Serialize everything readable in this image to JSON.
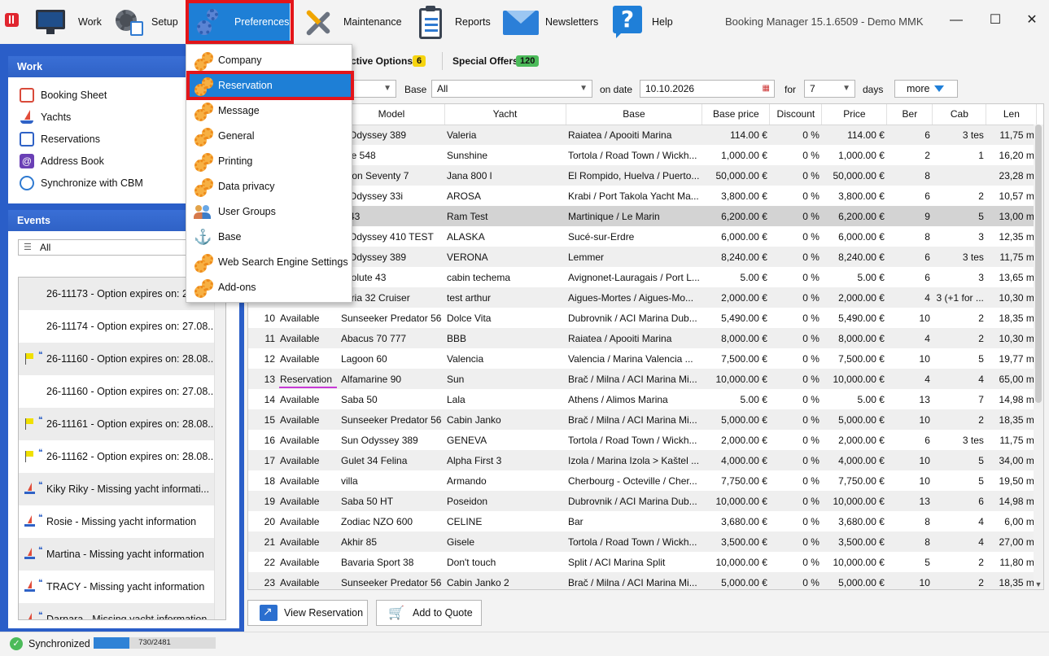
{
  "window": {
    "title": "Booking Manager 15.1.6509 - Demo MMK",
    "controls": {
      "minimize": "—",
      "maximize": "☐",
      "close": "✕"
    }
  },
  "toolbar": {
    "items": [
      {
        "label": "Work",
        "icon": "monitor-icon"
      },
      {
        "label": "Setup",
        "icon": "gear-clipboard-icon"
      },
      {
        "label": "Preferences",
        "icon": "gears-icon",
        "active": true
      },
      {
        "label": "Maintenance",
        "icon": "tools-icon"
      },
      {
        "label": "Reports",
        "icon": "clipboard-icon"
      },
      {
        "label": "Newsletters",
        "icon": "envelope-icon"
      },
      {
        "label": "Help",
        "icon": "help-icon",
        "glyph": "?"
      }
    ]
  },
  "preferences_menu": {
    "items": [
      {
        "label": "Company",
        "icon": "gears-icon"
      },
      {
        "label": "Reservation",
        "icon": "gears-icon",
        "active": true
      },
      {
        "label": "Message",
        "icon": "gears-icon"
      },
      {
        "label": "General",
        "icon": "gears-icon"
      },
      {
        "label": "Printing",
        "icon": "gears-icon"
      },
      {
        "label": "Data privacy",
        "icon": "gears-icon"
      },
      {
        "label": "User Groups",
        "icon": "user-groups-icon"
      },
      {
        "label": "Base",
        "icon": "anchor-icon",
        "glyph": "⚓"
      },
      {
        "label": "Web Search Engine Settings",
        "icon": "gears-icon"
      },
      {
        "label": "Add-ons",
        "icon": "gears-icon"
      }
    ]
  },
  "work_panel": {
    "title": "Work",
    "items": [
      {
        "label": "Booking Sheet",
        "icon": "calendar-icon"
      },
      {
        "label": "Yachts",
        "icon": "sailboat-icon"
      },
      {
        "label": "Reservations",
        "icon": "reservations-icon"
      },
      {
        "label": "Address Book",
        "icon": "address-book-icon",
        "glyph": "@"
      },
      {
        "label": "Synchronize with CBM",
        "icon": "sync-icon"
      }
    ]
  },
  "events_panel": {
    "title": "Events",
    "filter": "All",
    "items": [
      {
        "text": "26-11173 - Option expires on: 27.08...",
        "icon": ""
      },
      {
        "text": "26-11174 - Option expires on: 27.08...",
        "icon": ""
      },
      {
        "text": "26-11160 - Option expires on: 28.08...",
        "icon": "flag"
      },
      {
        "text": "26-11160 - Option expires on: 27.08...",
        "icon": ""
      },
      {
        "text": "26-11161 - Option expires on: 28.08...",
        "icon": "flag"
      },
      {
        "text": "26-11162 - Option expires on: 28.08...",
        "icon": "flag"
      },
      {
        "text": "Kiky Riky - Missing yacht informati...",
        "icon": "boat"
      },
      {
        "text": "Rosie - Missing yacht information",
        "icon": "boat"
      },
      {
        "text": "Martina - Missing yacht information",
        "icon": "boat"
      },
      {
        "text": "TRACY - Missing yacht information",
        "icon": "boat"
      },
      {
        "text": "Darnara - Missing yacht information",
        "icon": "boat"
      }
    ]
  },
  "summary": {
    "active_options_label": "ctive Options",
    "active_options_count": "6",
    "special_offers_label": "Special Offers",
    "special_offers_count": "120"
  },
  "filters": {
    "base_label": "Base",
    "base_value": "All",
    "date_label": "on date",
    "date_value": "10.10.2026",
    "for_label": "for",
    "days_value": "7",
    "days_label": "days",
    "more_label": "more"
  },
  "grid": {
    "columns": [
      "",
      "",
      "Model",
      "Yacht",
      "Base",
      "Base price",
      "Discount",
      "Price",
      "Ber",
      "Cab",
      "Len"
    ],
    "rows": [
      [
        "",
        "",
        "n Odyssey 389",
        "Valeria",
        "Raiatea / Apooiti Marina",
        "114.00 €",
        "0 %",
        "114.00 €",
        "6",
        "3 tes",
        "11,75 m"
      ],
      [
        "",
        "",
        "nse 548",
        "Sunshine",
        "Tortola / Road Town / Wickh...",
        "1,000.00 €",
        "0 %",
        "1,000.00 €",
        "2",
        "1",
        "16,20 m"
      ],
      [
        "",
        "",
        "goon Seventy 7",
        "Jana 800 l",
        "El Rompido, Huelva / Puerto...",
        "50,000.00 €",
        "0 %",
        "50,000.00 €",
        "8",
        "",
        "23,28 m"
      ],
      [
        "",
        "",
        "n Odyssey 33i",
        "AROSA",
        "Krabi / Port Takola Yacht Ma...",
        "3,800.00 €",
        "0 %",
        "3,800.00 €",
        "6",
        "2",
        "10,57 m"
      ],
      [
        "",
        "",
        "n 43",
        "Ram Test",
        "Martinique / Le Marin",
        "6,200.00 €",
        "0 %",
        "6,200.00 €",
        "9",
        "5",
        "13,00 m"
      ],
      [
        "",
        "",
        "n Odyssey 410 TEST",
        "ALASKA",
        "Sucé-sur-Erdre",
        "6,000.00 €",
        "0 %",
        "6,000.00 €",
        "8",
        "3",
        "12,35 m"
      ],
      [
        "",
        "",
        "n Odyssey 389",
        "VERONA",
        "Lemmer",
        "8,240.00 €",
        "0 %",
        "8,240.00 €",
        "6",
        "3 tes",
        "11,75 m"
      ],
      [
        "",
        "",
        "bsolute 43",
        "cabin techema",
        "Avignonet-Lauragais / Port L...",
        "5.00 €",
        "0 %",
        "5.00 €",
        "6",
        "3",
        "13,65 m"
      ],
      [
        "",
        "",
        "varia 32 Cruiser",
        "test arthur",
        "Aigues-Mortes  / Aigues-Mo...",
        "2,000.00 €",
        "0 %",
        "2,000.00 €",
        "4",
        "3 (+1 for ...",
        "10,30 m"
      ],
      [
        "10",
        "Available",
        "Sunseeker Predator 56",
        "Dolce Vita",
        "Dubrovnik / ACI Marina Dub...",
        "5,490.00 €",
        "0 %",
        "5,490.00 €",
        "10",
        "2",
        "18,35 m"
      ],
      [
        "11",
        "Available",
        "Abacus 70 777",
        "BBB",
        "Raiatea / Apooiti Marina",
        "8,000.00 €",
        "0 %",
        "8,000.00 €",
        "4",
        "2",
        "10,30 m"
      ],
      [
        "12",
        "Available",
        "Lagoon 60",
        "Valencia",
        "Valencia / Marina Valencia ...",
        "7,500.00 €",
        "0 %",
        "7,500.00 €",
        "10",
        "5",
        "19,77 m"
      ],
      [
        "13",
        "Reservation",
        "Alfamarine 90",
        "Sun",
        "Brač / Milna / ACI Marina Mi...",
        "10,000.00 €",
        "0 %",
        "10,000.00 €",
        "4",
        "4",
        "65,00 m"
      ],
      [
        "14",
        "Available",
        "Saba 50",
        "Lala",
        "Athens / Alimos Marina",
        "5.00 €",
        "0 %",
        "5.00 €",
        "13",
        "7",
        "14,98 m"
      ],
      [
        "15",
        "Available",
        "Sunseeker Predator 56",
        "Cabin Janko",
        "Brač / Milna / ACI Marina Mi...",
        "5,000.00 €",
        "0 %",
        "5,000.00 €",
        "10",
        "2",
        "18,35 m"
      ],
      [
        "16",
        "Available",
        "Sun Odyssey 389",
        "GENEVA",
        "Tortola / Road Town / Wickh...",
        "2,000.00 €",
        "0 %",
        "2,000.00 €",
        "6",
        "3 tes",
        "11,75 m"
      ],
      [
        "17",
        "Available",
        "Gulet 34 Felina",
        "Alpha First 3",
        "Izola / Marina Izola > Kaštel ...",
        "4,000.00 €",
        "0 %",
        "4,000.00 €",
        "10",
        "5",
        "34,00 m"
      ],
      [
        "18",
        "Available",
        "villa",
        "Armando",
        "Cherbourg - Octeville / Cher...",
        "7,750.00 €",
        "0 %",
        "7,750.00 €",
        "10",
        "5",
        "19,50 m"
      ],
      [
        "19",
        "Available",
        "Saba 50 HT",
        "Poseidon",
        "Dubrovnik / ACI Marina Dub...",
        "10,000.00 €",
        "0 %",
        "10,000.00 €",
        "13",
        "6",
        "14,98 m"
      ],
      [
        "20",
        "Available",
        "Zodiac NZO 600",
        "CELINE",
        "Bar",
        "3,680.00 €",
        "0 %",
        "3,680.00 €",
        "8",
        "4",
        "6,00 m"
      ],
      [
        "21",
        "Available",
        "Akhir 85",
        "Gisele",
        "Tortola / Road Town / Wickh...",
        "3,500.00 €",
        "0 %",
        "3,500.00 €",
        "8",
        "4",
        "27,00 m"
      ],
      [
        "22",
        "Available",
        "Bavaria Sport 38",
        "Don't touch",
        "Split / ACI Marina Split",
        "10,000.00 €",
        "0 %",
        "10,000.00 €",
        "5",
        "2",
        "11,80 m"
      ],
      [
        "23",
        "Available",
        "Sunseeker Predator 56",
        "Cabin Janko 2",
        "Brač / Milna / ACI Marina Mi...",
        "5,000.00 €",
        "0 %",
        "5,000.00 €",
        "10",
        "2",
        "18,35 m"
      ]
    ],
    "selected_row_index": 4
  },
  "actions": {
    "view_reservation": "View Reservation",
    "add_to_quote": "Add to Quote"
  },
  "status": {
    "sync_label": "Synchronized",
    "progress_text": "730/2481",
    "progress_fraction": 0.294
  },
  "colors": {
    "accent": "#1e7fd6",
    "highlight_outline": "#e3151a",
    "panel_header": "#2f62c6",
    "options_badge": "#f6d40f",
    "offers_badge": "#4cbb5a"
  }
}
